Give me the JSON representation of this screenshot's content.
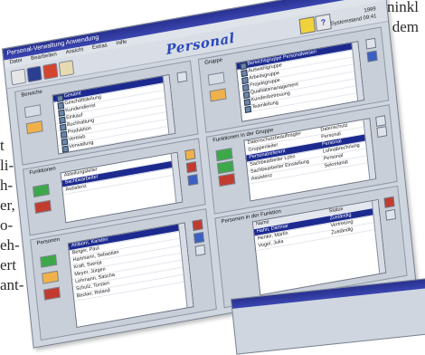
{
  "page_text": {
    "top_lines": [
      "ninkl",
      "dem"
    ],
    "side_lines": [
      "t",
      "li-",
      "h-",
      "er,",
      "o-",
      "eh-",
      "ert",
      "ant-"
    ]
  },
  "window": {
    "title": "Personal-Verwaltung Anwendung",
    "menu": [
      "Datei",
      "Bearbeiten",
      "Ansicht",
      "Extras",
      "Hilfe"
    ],
    "app_title": "Personal",
    "help_label": "?",
    "date_lines": [
      "1999",
      "Systemstand 09:41"
    ]
  },
  "left": {
    "bereiche": {
      "label": "Bereiche",
      "items": [
        "Gesamt",
        "Geschäftsleitung",
        "Kundendienst",
        "Einkauf",
        "Buchhaltung",
        "Produktion",
        "Vertrieb",
        "Verwaltung"
      ],
      "selected": 0
    },
    "funktionen": {
      "label": "Funktionen",
      "items": [
        "Abteilungsleiter",
        "Sachbearbeiter",
        "Assistenz"
      ],
      "selected": 1
    },
    "personen": {
      "label": "Personen",
      "items": [
        "Ahlborn, Karsten",
        "Berger, Paul",
        "Hartmann, Sebastian",
        "Kraft, Svenja",
        "Meyer, Jürgen",
        "Lehmann, Sascha",
        "Schulz, Torsten",
        "Becker, Roland"
      ],
      "selected": 0
    }
  },
  "right": {
    "gruppe": {
      "label": "Gruppe",
      "items": [
        "Bereichsgruppe Personalwesen",
        "Auswahlgruppe",
        "Arbeitsgruppe",
        "Projektgruppe",
        "Qualitätsmanagement",
        "Kundenbetreuung",
        "Teamleitung"
      ],
      "selected": 0
    },
    "funktionen_gruppe": {
      "label": "Funktionen in der Gruppe",
      "rows": [
        [
          "Datenschutzbeauftragter",
          "Datenschutz"
        ],
        [
          "Gruppenleiter",
          "Personal"
        ],
        [
          "Personalreferent",
          "Personal"
        ],
        [
          "Sachbearbeiter Lohn",
          "Lohnabrechnung"
        ],
        [
          "Sachbearbeiter Einstellung",
          "Personal"
        ],
        [
          "Assistenz",
          "Sekretariat"
        ]
      ],
      "selected": 2
    },
    "personen_funktion": {
      "label": "Personen in der Funktion",
      "columns": [
        "Name",
        "Status"
      ],
      "rows": [
        [
          "Hahn, Dietmar",
          "Zuständig"
        ],
        [
          "Henke, Martin",
          "Vertretung"
        ],
        [
          "Vogel, Julia",
          "Zuständig"
        ]
      ],
      "selected": 0
    }
  },
  "colors": {
    "titlebar": "#28318f",
    "selection": "#1c2a8f",
    "app_title": "#2a49b8"
  }
}
